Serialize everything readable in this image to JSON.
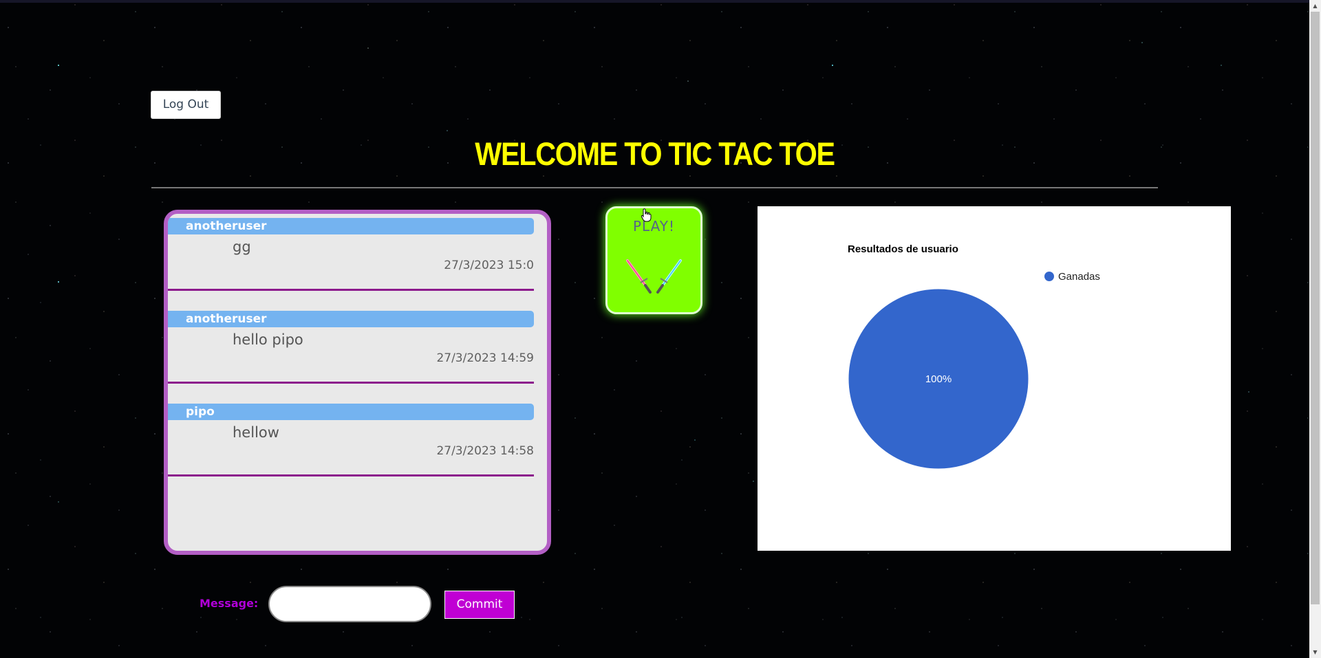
{
  "header": {
    "logout_label": "Log Out",
    "title": "WELCOME TO TIC TAC TOE"
  },
  "chat": {
    "messages": [
      {
        "user": "anotheruser",
        "text": "gg",
        "time": "27/3/2023 15:0"
      },
      {
        "user": "anotheruser",
        "text": "hello pipo",
        "time": "27/3/2023 14:59"
      },
      {
        "user": "pipo",
        "text": "hellow",
        "time": "27/3/2023 14:58"
      }
    ]
  },
  "play": {
    "label": "PLAY!",
    "icon": "lightsabers-icon"
  },
  "composer": {
    "label": "Message:",
    "input_value": "",
    "commit_label": "Commit"
  },
  "colors": {
    "title": "#ffff00",
    "chat_border": "#b35fc5",
    "chat_user_bar": "#74b3f0",
    "chat_divider": "#8c1a8c",
    "play_button": "#80ff00",
    "commit_button": "#c000d4",
    "pie_slice": "#3366cc"
  },
  "chart_data": {
    "type": "pie",
    "title": "Resultados de usuario",
    "categories": [
      "Ganadas"
    ],
    "values": [
      100
    ],
    "slice_labels": [
      "100%"
    ],
    "legend_position": "right",
    "colors": [
      "#3366cc"
    ]
  }
}
